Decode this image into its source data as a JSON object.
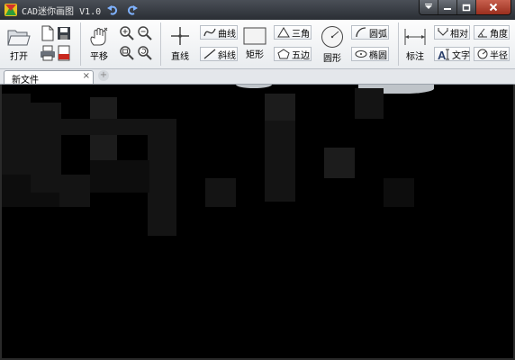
{
  "window": {
    "title": "CAD迷你画图 V1.0"
  },
  "ribbon": {
    "open": "打开",
    "pan": "平移",
    "line": "直线",
    "curve": "曲线",
    "slant": "斜线",
    "rect": "矩形",
    "triangle": "三角",
    "pentagon": "五边",
    "circle": "圆形",
    "arc": "圆弧",
    "ellipse": "椭圆",
    "dimension": "标注",
    "relative": "相对",
    "angle": "角度",
    "text": "文字",
    "radius": "半径"
  },
  "tabs": {
    "doc": "新文件",
    "close": "×",
    "add": "+"
  },
  "colors": {
    "titlebar": "#2a2e34",
    "ribbon": "#eef1f4",
    "canvas": "#000000",
    "close_button": "#b0412d"
  }
}
